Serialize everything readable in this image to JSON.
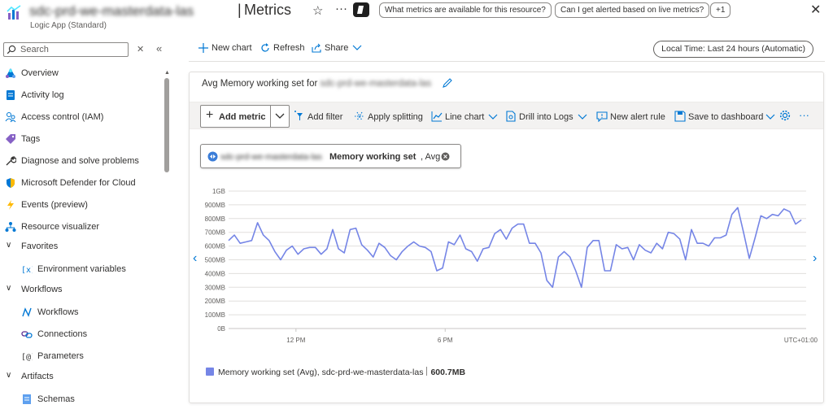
{
  "header": {
    "resource_name": "sdc-prd-we-masterdata-las",
    "separator": "|",
    "page_title": "Metrics",
    "subtitle": "Logic App (Standard)",
    "star": "☆",
    "more": "···",
    "suggestions": [
      "What metrics are available for this resource?",
      "Can I get alerted based on live metrics?"
    ],
    "more_suggestions": "+1",
    "close": "✕"
  },
  "sidebar": {
    "search_placeholder": "Search",
    "close": "✕",
    "collapse": "«",
    "items": [
      {
        "label": "Overview",
        "icon": "overview-icon"
      },
      {
        "label": "Activity log",
        "icon": "activity-log-icon"
      },
      {
        "label": "Access control (IAM)",
        "icon": "people-icon"
      },
      {
        "label": "Tags",
        "icon": "tag-icon"
      },
      {
        "label": "Diagnose and solve problems",
        "icon": "wrench-icon"
      },
      {
        "label": "Microsoft Defender for Cloud",
        "icon": "shield-icon"
      },
      {
        "label": "Events (preview)",
        "icon": "lightning-icon"
      },
      {
        "label": "Resource visualizer",
        "icon": "hierarchy-icon"
      }
    ],
    "groups": [
      {
        "label": "Favorites",
        "children": [
          "Environment variables"
        ]
      },
      {
        "label": "Workflows",
        "children": [
          "Workflows",
          "Connections",
          "Parameters"
        ]
      },
      {
        "label": "Artifacts",
        "children": [
          "Schemas"
        ]
      }
    ]
  },
  "toolbar": {
    "new_chart": "New chart",
    "refresh": "Refresh",
    "share": "Share",
    "time_range": "Local Time: Last 24 hours (Automatic)"
  },
  "chart_card": {
    "title_prefix": "Avg Memory working set for",
    "resource_name": "sdc-prd-we-masterdata-las",
    "toolbar": {
      "add_metric": "Add metric",
      "add_filter": "Add filter",
      "apply_splitting": "Apply splitting",
      "line_chart": "Line chart",
      "drill_logs": "Drill into Logs",
      "new_alert": "New alert rule",
      "save_dashboard": "Save to dashboard",
      "more": "···"
    },
    "metric_pill": {
      "resource": "sdc-prd-we-masterdata-las",
      "metric": "Memory working set",
      "aggregation": ", Avg"
    },
    "legend": {
      "label": "Memory working set (Avg), sdc-prd-we-masterdata-las",
      "value": "600.7MB"
    },
    "series_color": "#7585e6"
  },
  "chart_data": {
    "type": "line",
    "title": "Avg Memory working set for sdc-prd-we-masterdata-las",
    "xlabel": "",
    "ylabel": "",
    "y_unit": "MB",
    "ylim": [
      0,
      1000
    ],
    "y_ticks": [
      0,
      100,
      200,
      300,
      400,
      500,
      600,
      700,
      800,
      900,
      1000
    ],
    "y_tick_labels": [
      "0B",
      "100MB",
      "200MB",
      "300MB",
      "400MB",
      "500MB",
      "600MB",
      "700MB",
      "800MB",
      "900MB",
      "1GB"
    ],
    "x_tick_labels": [
      "12 PM",
      "6 PM",
      "UTC+01:00"
    ],
    "x_tick_hours": [
      2.8,
      9,
      23.8
    ],
    "xlim_hours": [
      0,
      24
    ],
    "legend_position": "bottom-left",
    "grid": true,
    "series": [
      {
        "name": "Memory working set (Avg), sdc-prd-we-masterdata-las",
        "x_hours": [
          0,
          0.33,
          0.66,
          0.99,
          1.32,
          1.65,
          1.98,
          2.31,
          2.64,
          2.97,
          3.3,
          3.63,
          3.96,
          4.29,
          4.62,
          4.95,
          5.28,
          5.61,
          5.94,
          6.27,
          6.6,
          6.93,
          7.26,
          7.59,
          7.92,
          8.25,
          8.58,
          8.91,
          9.24,
          9.57,
          9.9,
          10.23,
          10.56,
          10.89,
          11.22,
          11.55,
          11.88,
          12.21,
          12.54,
          12.87,
          13.2,
          13.53,
          13.86,
          14.19,
          14.52,
          14.85,
          15.18,
          15.51,
          15.84,
          16.17,
          16.5,
          16.83,
          17.16,
          17.49,
          17.82,
          18.15,
          18.48,
          18.81,
          19.14,
          19.47,
          19.8,
          20.13,
          20.46,
          20.79,
          21.12,
          21.45,
          21.78,
          22.11,
          22.44,
          22.77,
          23.1,
          23.43,
          23.76
        ],
        "values": [
          640,
          680,
          620,
          630,
          640,
          770,
          680,
          640,
          560,
          500,
          570,
          600,
          540,
          580,
          590,
          590,
          540,
          580,
          720,
          580,
          550,
          720,
          730,
          610,
          570,
          520,
          620,
          590,
          530,
          500,
          560,
          600,
          630,
          600,
          590,
          560,
          420,
          440,
          630,
          610,
          680,
          580,
          560,
          490,
          580,
          590,
          690,
          720,
          650,
          730,
          760,
          760,
          620,
          620,
          550,
          350,
          300,
          520,
          560,
          520,
          420,
          300,
          590,
          640,
          640,
          420,
          420,
          610,
          580,
          590,
          500,
          610,
          570,
          550,
          620,
          580,
          700,
          690,
          650,
          500,
          720,
          620,
          620,
          600,
          660,
          660,
          680,
          830,
          880,
          700,
          510,
          660,
          820,
          800,
          830,
          820,
          870,
          850,
          760,
          790
        ]
      }
    ]
  }
}
